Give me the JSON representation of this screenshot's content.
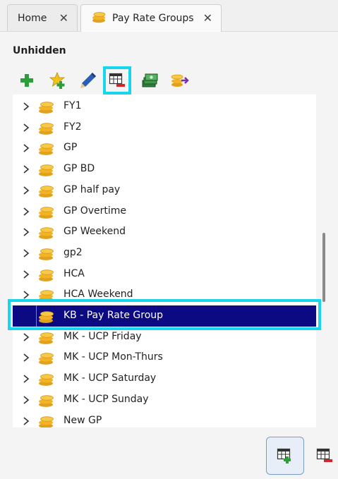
{
  "tabs": [
    {
      "label": "Home",
      "close": "✕"
    },
    {
      "label": "Pay Rate Groups",
      "close": "✕"
    }
  ],
  "section_title": "Unhidden",
  "toolbar": {
    "buttons": [
      {
        "name": "add-icon"
      },
      {
        "name": "add-star-icon"
      },
      {
        "name": "edit-pencil-icon"
      },
      {
        "name": "remove-table-icon",
        "highlighted": true
      },
      {
        "name": "money-stack-icon"
      },
      {
        "name": "coins-export-icon"
      }
    ]
  },
  "tree": {
    "items": [
      {
        "label": "FY1"
      },
      {
        "label": "FY2"
      },
      {
        "label": "GP"
      },
      {
        "label": "GP BD"
      },
      {
        "label": "GP half pay"
      },
      {
        "label": "GP Overtime"
      },
      {
        "label": "GP Weekend"
      },
      {
        "label": "gp2"
      },
      {
        "label": "HCA"
      },
      {
        "label": "HCA Weekend"
      },
      {
        "label": "KB - Pay Rate Group",
        "selected": true
      },
      {
        "label": "MK - UCP Friday"
      },
      {
        "label": "MK - UCP Mon-Thurs"
      },
      {
        "label": "MK - UCP Saturday"
      },
      {
        "label": "MK - UCP Sunday"
      },
      {
        "label": "New GP"
      }
    ]
  },
  "bottom_buttons": [
    {
      "name": "add-table-icon"
    },
    {
      "name": "remove-table-icon"
    }
  ],
  "colors": {
    "selection": "#0c0a82",
    "highlight": "#17d4ef",
    "coin": "#f2b325",
    "add_green": "#2e9e3a"
  }
}
